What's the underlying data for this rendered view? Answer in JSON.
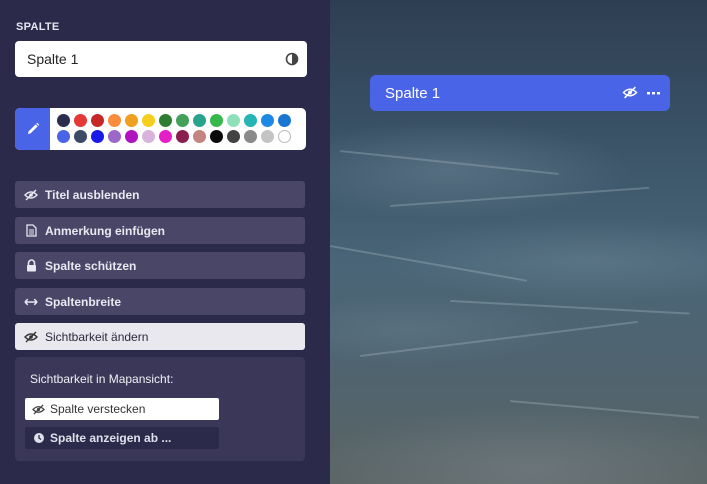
{
  "sidebar": {
    "section_label": "SPALTE",
    "name_field": {
      "value": "Spalte 1",
      "icon": "contrast-icon"
    },
    "colors": {
      "edit_icon": "pencil-icon",
      "row1": [
        "#2a2d4e",
        "#e53935",
        "#c62828",
        "#fb8c3c",
        "#f0a020",
        "#f6cf1e",
        "#2e7d32",
        "#43a05a",
        "#2aa38c",
        "#37b84a",
        "#8ee0b8",
        "#26b5b5",
        "#1e88e5",
        "#1976d2"
      ],
      "row2": [
        "#4a64e8",
        "#3d4a66",
        "#1a1ae6",
        "#9c68c8",
        "#b012c0",
        "#d8b4dc",
        "#e61ec8",
        "#8b1e50",
        "#c48480",
        "#0a0a0a",
        "#424242",
        "#8a8a8a",
        "#c4c4c4",
        "#ffffff"
      ]
    },
    "menu": [
      {
        "label": "Titel ausblenden",
        "icon": "eye-slash-icon"
      },
      {
        "label": "Anmerkung einfügen",
        "icon": "document-icon"
      },
      {
        "label": "Spalte schützen",
        "icon": "lock-icon"
      },
      {
        "label": "Spaltenbreite",
        "icon": "width-arrows-icon"
      },
      {
        "label": "Sichtbarkeit ändern",
        "icon": "eye-slash-icon"
      }
    ],
    "visibility": {
      "title": "Sichtbarkeit in Mapansicht:",
      "options": [
        {
          "label": "Spalte verstecken",
          "icon": "eye-slash-icon"
        },
        {
          "label": "Spalte anzeigen ab ...",
          "icon": "clock-icon"
        }
      ]
    }
  },
  "canvas": {
    "column": {
      "title": "Spalte 1",
      "icons": [
        "eye-slash-icon",
        "more-icon"
      ]
    }
  },
  "colors": {
    "accent": "#4a64e8",
    "sidebar_bg": "#2c2a4a",
    "menu_bg": "#4a4668"
  }
}
